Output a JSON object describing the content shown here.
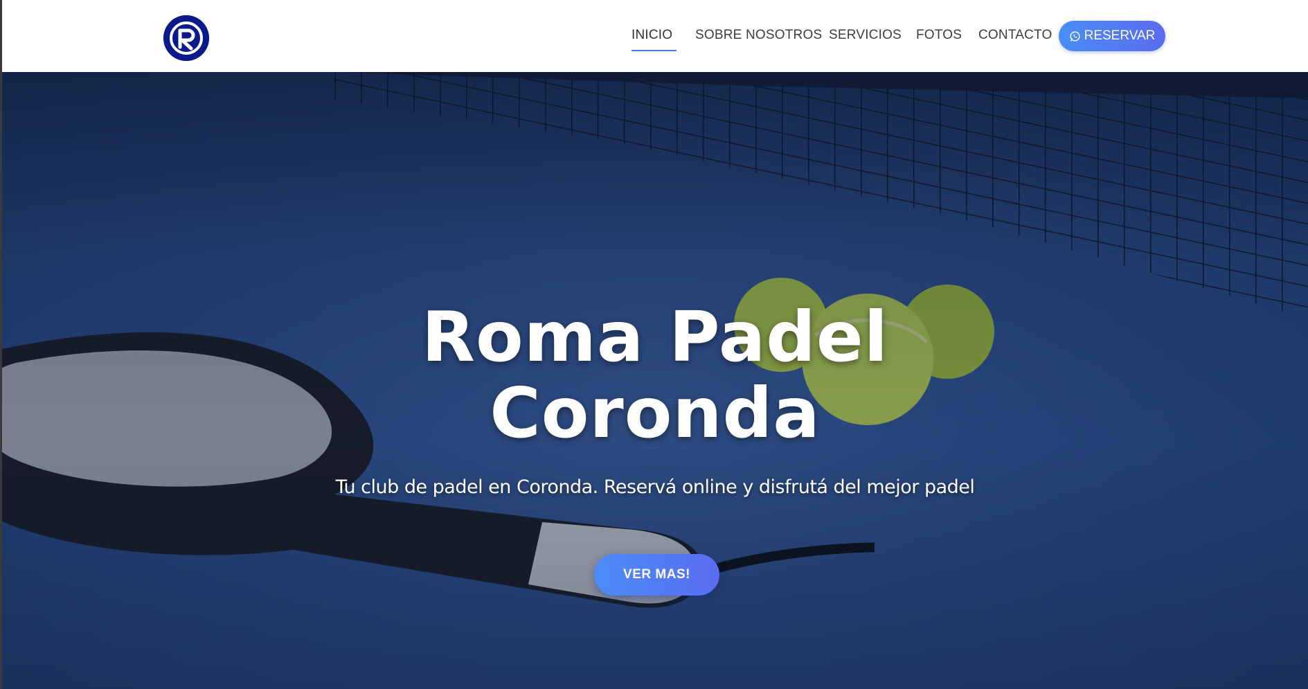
{
  "brand": {
    "logo_letter": "R",
    "logo_color": "#0b1a8a"
  },
  "nav": {
    "items": [
      {
        "label": "INICIO",
        "active": true
      },
      {
        "label": "SOBRE NOSOTROS",
        "active": false
      },
      {
        "label": "SERVICIOS",
        "active": false
      },
      {
        "label": "FOTOS",
        "active": false
      },
      {
        "label": "CONTACTO",
        "active": false
      }
    ],
    "cta": {
      "label": "RESERVAR",
      "icon": "whatsapp-icon"
    }
  },
  "hero": {
    "title_line1": "Roma Padel",
    "title_line2": "Coronda",
    "subtitle": "Tu club de padel en Coronda. Reservá online y disfrutá del mejor padel",
    "button_label": "VER MAS!"
  },
  "colors": {
    "accent_start": "#4a8df7",
    "accent_end": "#5b6cf0",
    "underline": "#4f78ea"
  }
}
